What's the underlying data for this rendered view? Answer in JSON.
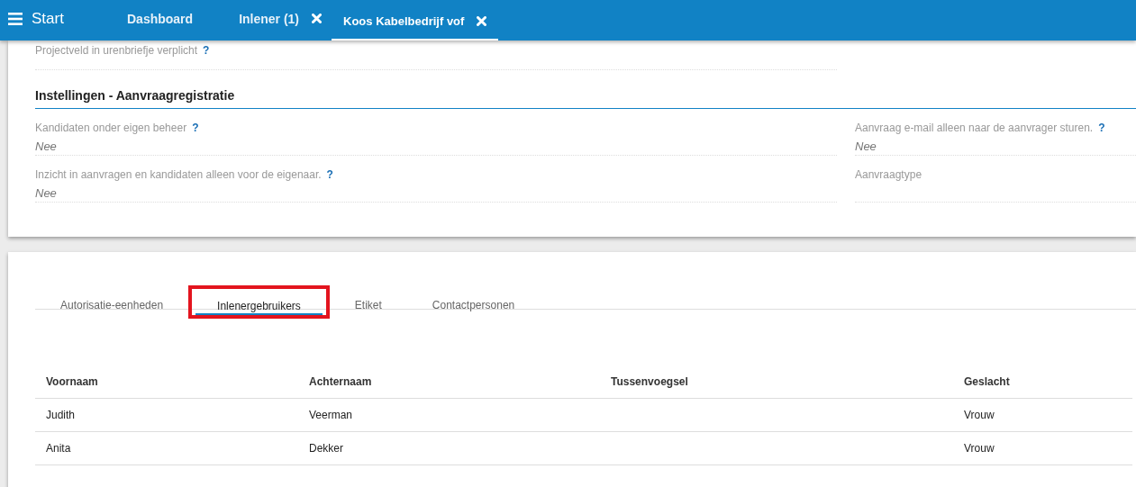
{
  "header": {
    "menu_label": "Start",
    "tabs": [
      {
        "label": "Dashboard",
        "closable": false,
        "selected": false
      },
      {
        "label": "Inlener (1)",
        "closable": true,
        "selected": false
      },
      {
        "label": "Koos Kabelbedrijf vof",
        "closable": true,
        "selected": true
      }
    ]
  },
  "top_field": {
    "label": "Projectveld in urenbriefje verplicht",
    "help": "?"
  },
  "section": {
    "title": "Instellingen - Aanvraagregistratie",
    "fields": [
      {
        "label": "Kandidaten onder eigen beheer",
        "help": "?",
        "value": "Nee"
      },
      {
        "label": "Aanvraag e-mail alleen naar de aanvrager sturen.",
        "help": "?",
        "value": "Nee"
      },
      {
        "label": "Inzicht in aanvragen en kandidaten alleen voor de eigenaar.",
        "help": "?",
        "value": "Nee"
      },
      {
        "label": "Aanvraagtype"
      }
    ]
  },
  "tabs": [
    {
      "label": "Autorisatie-eenheden",
      "selected": false,
      "highlighted": false
    },
    {
      "label": "Inlenergebruikers",
      "selected": true,
      "highlighted": true
    },
    {
      "label": "Etiket",
      "selected": false,
      "highlighted": false
    },
    {
      "label": "Contactpersonen",
      "selected": false,
      "highlighted": false
    }
  ],
  "table": {
    "columns": [
      "Voornaam",
      "Achternaam",
      "Tussenvoegsel",
      "Geslacht"
    ],
    "rows": [
      [
        "Judith",
        "Veerman",
        "",
        "Vrouw"
      ],
      [
        "Anita",
        "Dekker",
        "",
        "Vrouw"
      ]
    ]
  }
}
